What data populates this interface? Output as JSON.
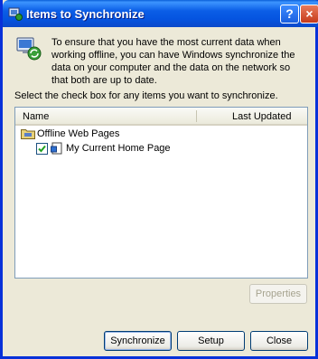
{
  "window": {
    "title": "Items to Synchronize",
    "help_label": "?",
    "close_label": "×"
  },
  "info": {
    "text": "To ensure that you have the most current data when working offline, you can have Windows synchronize the data on your computer and the data on the network so that both are up to date."
  },
  "prompt": "Select the check box for any items you want to synchronize.",
  "list": {
    "columns": [
      "Name",
      "Last Updated"
    ],
    "parent": {
      "label": "Offline Web Pages",
      "icon": "offline-folder-icon"
    },
    "items": [
      {
        "label": "My Current Home Page",
        "checked": true,
        "last_updated": ""
      }
    ]
  },
  "buttons": {
    "properties": {
      "label": "Properties",
      "enabled": false
    },
    "synchronize": {
      "label": "Synchronize"
    },
    "setup": {
      "label": "Setup"
    },
    "close": {
      "label": "Close"
    }
  },
  "colors": {
    "titlebar": "#0554e0",
    "dialog_bg": "#ece9d8",
    "close_button": "#c53a1a"
  }
}
